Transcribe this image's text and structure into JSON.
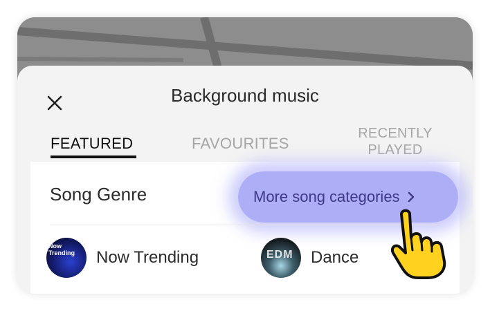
{
  "sheet": {
    "title": "Background music",
    "close_icon": "close-icon"
  },
  "tabs": [
    {
      "label": "FEATURED",
      "active": true
    },
    {
      "label": "FAVOURITES",
      "active": false
    },
    {
      "label": "RECENTLY PLAYED",
      "active": false
    }
  ],
  "genres": {
    "heading": "Song Genre",
    "more_link": "More song categories",
    "more_icon": "chevron-right-icon",
    "items": [
      {
        "name": "Now Trending",
        "thumb_text": "Now Trending"
      },
      {
        "name": "Dance",
        "thumb_text": "EDM"
      }
    ]
  },
  "colors": {
    "highlight": "#a0a0f5",
    "link": "#3e3a86",
    "pointer_fill": "#ffd21f"
  }
}
